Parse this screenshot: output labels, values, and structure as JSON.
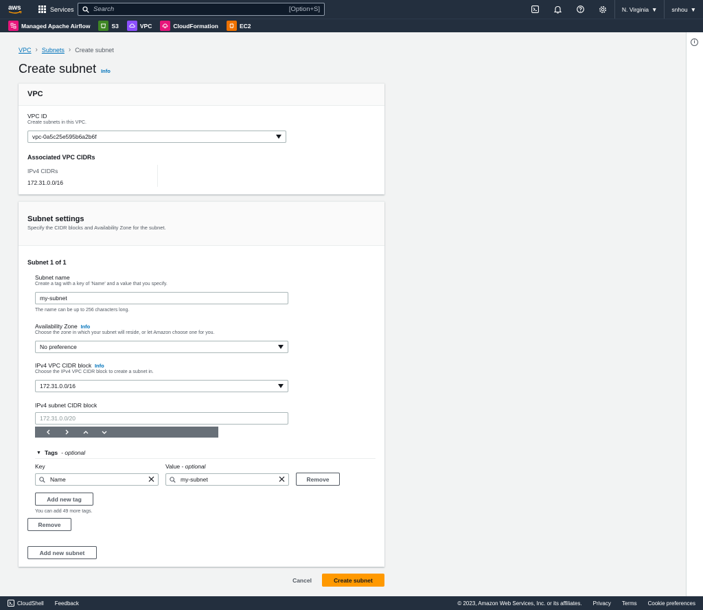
{
  "topbar": {
    "logo_text": "aws",
    "services_label": "Services",
    "search_placeholder": "Search",
    "search_shortcut": "[Option+S]",
    "region_label": "N. Virginia",
    "user_label": "snhou"
  },
  "favorites": [
    {
      "label": "Managed Apache Airflow",
      "color": "#e7157b",
      "icon": "airflow-icon"
    },
    {
      "label": "S3",
      "color": "#3f8624",
      "icon": "s3-icon"
    },
    {
      "label": "VPC",
      "color": "#8c4fff",
      "icon": "vpc-icon"
    },
    {
      "label": "CloudFormation",
      "color": "#e7157b",
      "icon": "cloudformation-icon"
    },
    {
      "label": "EC2",
      "color": "#ed7100",
      "icon": "ec2-icon"
    }
  ],
  "breadcrumb": {
    "items": [
      "VPC",
      "Subnets"
    ],
    "current": "Create subnet"
  },
  "page": {
    "title": "Create subnet",
    "info": "Info"
  },
  "vpc_panel": {
    "title": "VPC",
    "vpc_id_label": "VPC ID",
    "vpc_id_desc": "Create subnets in this VPC.",
    "vpc_id_value": "vpc-0a5c25e595b6a2b6f",
    "cidrs_heading": "Associated VPC CIDRs",
    "ipv4_label": "IPv4 CIDRs",
    "ipv4_value": "172.31.0.0/16"
  },
  "subnet_panel": {
    "title": "Subnet settings",
    "desc": "Specify the CIDR blocks and Availability Zone for the subnet.",
    "subnet_heading": "Subnet 1 of 1",
    "name_label": "Subnet name",
    "name_desc": "Create a tag with a key of 'Name' and a value that you specify.",
    "name_value": "my-subnet",
    "name_constraint": "The name can be up to 256 characters long.",
    "az_label": "Availability Zone",
    "az_info": "Info",
    "az_desc": "Choose the zone in which your subnet will reside, or let Amazon choose one for you.",
    "az_value": "No preference",
    "vpc_cidr_label": "IPv4 VPC CIDR block",
    "vpc_cidr_info": "Info",
    "vpc_cidr_desc": "Choose the IPv4 VPC CIDR block to create a subnet in.",
    "vpc_cidr_value": "172.31.0.0/16",
    "subnet_cidr_label": "IPv4 subnet CIDR block",
    "subnet_cidr_placeholder": "172.31.0.0/20",
    "tags_label": "Tags",
    "tags_optional": "optional",
    "key_header": "Key",
    "value_header": "Value",
    "value_optional": "optional",
    "tag_key": "Name",
    "tag_value": "my-subnet",
    "remove_tag_label": "Remove",
    "add_tag_label": "Add new tag",
    "tags_limit": "You can add 49 more tags.",
    "remove_subnet_label": "Remove",
    "add_subnet_label": "Add new subnet"
  },
  "actions": {
    "cancel": "Cancel",
    "create": "Create subnet"
  },
  "footer": {
    "cloudshell": "CloudShell",
    "feedback": "Feedback",
    "copyright": "© 2023, Amazon Web Services, Inc. or its affiliates.",
    "privacy": "Privacy",
    "terms": "Terms",
    "cookies": "Cookie preferences"
  }
}
